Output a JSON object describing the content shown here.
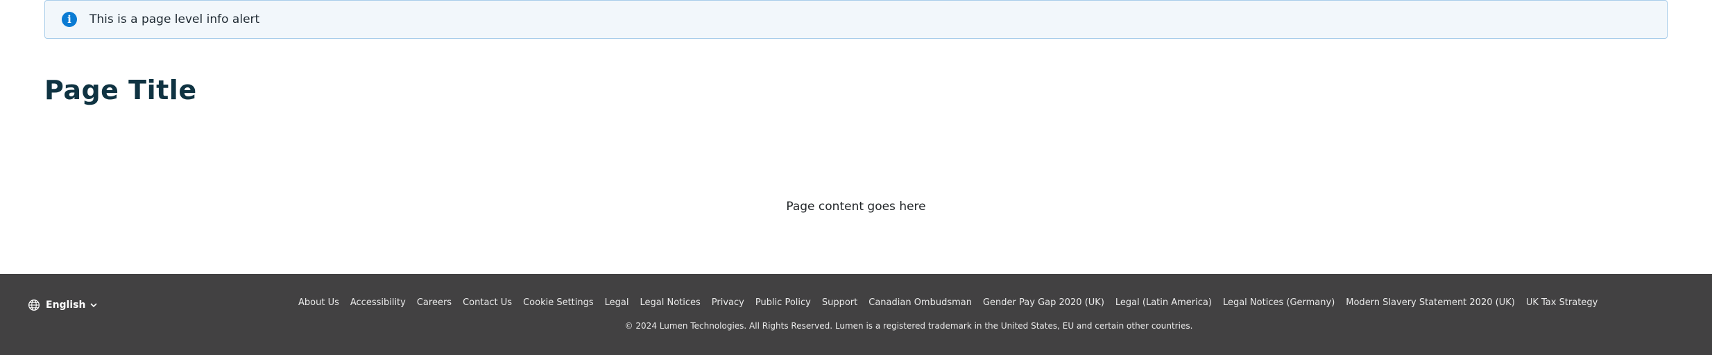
{
  "alert": {
    "icon": "info-icon",
    "text": "This is a page level info alert"
  },
  "page": {
    "title": "Page Title",
    "content": "Page content goes here"
  },
  "footer": {
    "language": {
      "icon": "globe-icon",
      "label": "English",
      "chevron": "chevron-down-icon"
    },
    "links": [
      "About Us",
      "Accessibility",
      "Careers",
      "Contact Us",
      "Cookie Settings",
      "Legal",
      "Legal Notices",
      "Privacy",
      "Public Policy",
      "Support",
      "Canadian Ombudsman",
      "Gender Pay Gap 2020 (UK)",
      "Legal (Latin America)",
      "Legal Notices (Germany)",
      "Modern Slavery Statement 2020 (UK)",
      "UK Tax Strategy"
    ],
    "copyright": "© 2024 Lumen Technologies. All Rights Reserved. Lumen is a registered trademark in the United States, EU and certain other countries."
  },
  "colors": {
    "alert_bg": "#f2f7fb",
    "alert_border": "#a9cdea",
    "info_blue": "#0b7bd3",
    "title": "#0f3342",
    "footer_bg": "#424142"
  }
}
